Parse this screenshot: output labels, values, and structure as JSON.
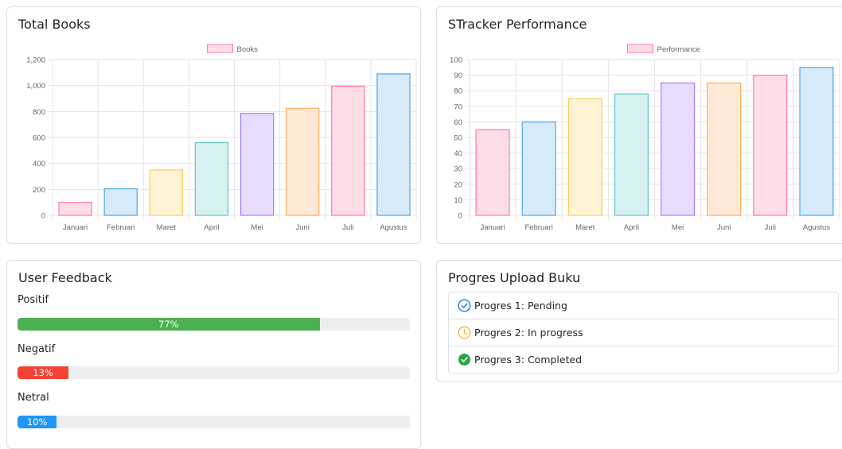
{
  "total_books": {
    "title": "Total Books",
    "chart_data": {
      "type": "bar",
      "categories": [
        "Januari",
        "Februari",
        "Maret",
        "April",
        "Mei",
        "Juni",
        "Juli",
        "Agustus"
      ],
      "series": [
        {
          "name": "Books",
          "values": [
            100,
            205,
            350,
            560,
            785,
            825,
            995,
            1090
          ]
        }
      ],
      "ylim": [
        0,
        1200
      ],
      "yticks": [
        0,
        200,
        400,
        600,
        800,
        1000,
        1200
      ],
      "ytick_labels": [
        "0",
        "200",
        "400",
        "600",
        "800",
        "1,000",
        "1,200"
      ],
      "grid": true,
      "legend": "top-center",
      "colors": {
        "fill": [
          "#ffdde6",
          "#d7eafa",
          "#fff3d6",
          "#d5f1f1",
          "#e7dcff",
          "#ffe8d6",
          "#ffdde6",
          "#d7eafa"
        ],
        "stroke": [
          "#ff7a9d",
          "#4aa8e8",
          "#ffcb5b",
          "#60c6c6",
          "#a77dff",
          "#ffac5e",
          "#ff7a9d",
          "#4aa8e8"
        ]
      }
    }
  },
  "performance": {
    "title": "STracker Performance",
    "chart_data": {
      "type": "bar",
      "categories": [
        "Januari",
        "Februari",
        "Maret",
        "April",
        "Mei",
        "Juni",
        "Juli",
        "Agustus"
      ],
      "series": [
        {
          "name": "Performance",
          "values": [
            55,
            60,
            75,
            78,
            85,
            85,
            90,
            95
          ]
        }
      ],
      "ylim": [
        0,
        100
      ],
      "yticks": [
        0,
        10,
        20,
        30,
        40,
        50,
        60,
        70,
        80,
        90,
        100
      ],
      "ytick_labels": [
        "0",
        "10",
        "20",
        "30",
        "40",
        "50",
        "60",
        "70",
        "80",
        "90",
        "100"
      ],
      "grid": true,
      "legend": "top-center",
      "colors": {
        "fill": [
          "#ffdde6",
          "#d7eafa",
          "#fff3d6",
          "#d5f1f1",
          "#e7dcff",
          "#ffe8d6",
          "#ffdde6",
          "#d7eafa"
        ],
        "stroke": [
          "#ff7a9d",
          "#4aa8e8",
          "#ffcb5b",
          "#60c6c6",
          "#a77dff",
          "#ffac5e",
          "#ff7a9d",
          "#4aa8e8"
        ]
      }
    }
  },
  "feedback": {
    "title": "User Feedback",
    "items": [
      {
        "label": "Positif",
        "percent": 77,
        "text": "77%",
        "color": "#4caf50"
      },
      {
        "label": "Negatif",
        "percent": 13,
        "text": "13%",
        "color": "#f44336"
      },
      {
        "label": "Netral",
        "percent": 10,
        "text": "10%",
        "color": "#2196f3"
      }
    ]
  },
  "upload": {
    "title": "Progres Upload Buku",
    "items": [
      {
        "text": "Progres 1: Pending",
        "icon": "check-circle-outline-icon",
        "color": "#1a73e8"
      },
      {
        "text": "Progres 2: In progress",
        "icon": "clock-icon",
        "color": "#f5b041"
      },
      {
        "text": "Progres 3: Completed",
        "icon": "check-circle-filled-icon",
        "color": "#28a745"
      }
    ]
  }
}
